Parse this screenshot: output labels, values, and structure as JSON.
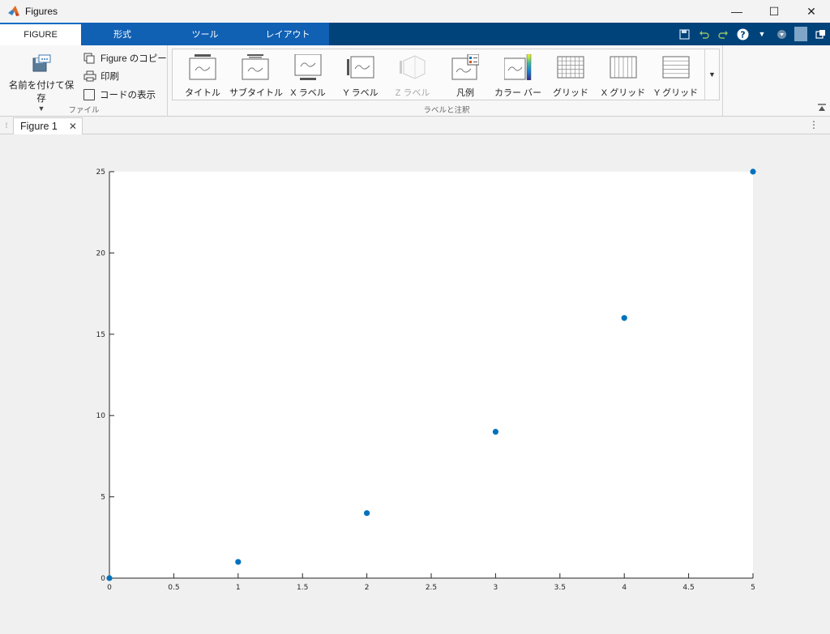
{
  "window": {
    "title": "Figures",
    "minimize": "—",
    "maximize": "☐",
    "close": "✕"
  },
  "ribbon_tabs": [
    {
      "label": "FIGURE"
    },
    {
      "label": "形式"
    },
    {
      "label": "ツール"
    },
    {
      "label": "レイアウト"
    }
  ],
  "file_group": {
    "save_as": "名前を付けて保存",
    "copy_figure": "Figure のコピー",
    "print": "印刷",
    "show_code": "コードの表示",
    "label": "ファイル"
  },
  "labels_group": {
    "label": "ラベルと注釈",
    "items": [
      {
        "label": "タイトル"
      },
      {
        "label": "サブタイトル"
      },
      {
        "label": "X ラベル"
      },
      {
        "label": "Y ラベル"
      },
      {
        "label": "Z ラベル"
      },
      {
        "label": "凡例"
      },
      {
        "label": "カラー バー"
      },
      {
        "label": "グリッド"
      },
      {
        "label": "X グリッド"
      },
      {
        "label": "Y グリッド"
      }
    ]
  },
  "document_tab": {
    "label": "Figure 1",
    "close": "✕"
  },
  "colors": {
    "ribbon_blue": "#00437a",
    "marker": "#0072bd"
  },
  "chart_data": {
    "type": "scatter",
    "x": [
      0,
      1,
      2,
      3,
      4,
      5
    ],
    "y": [
      0,
      1,
      4,
      9,
      16,
      25
    ],
    "xlim": [
      0,
      5
    ],
    "ylim": [
      0,
      25
    ],
    "xticks": [
      "0",
      "0.5",
      "1",
      "1.5",
      "2",
      "2.5",
      "3",
      "3.5",
      "4",
      "4.5",
      "5"
    ],
    "yticks": [
      "0",
      "5",
      "10",
      "15",
      "20",
      "25"
    ],
    "title": "",
    "xlabel": "",
    "ylabel": "",
    "grid": false
  }
}
